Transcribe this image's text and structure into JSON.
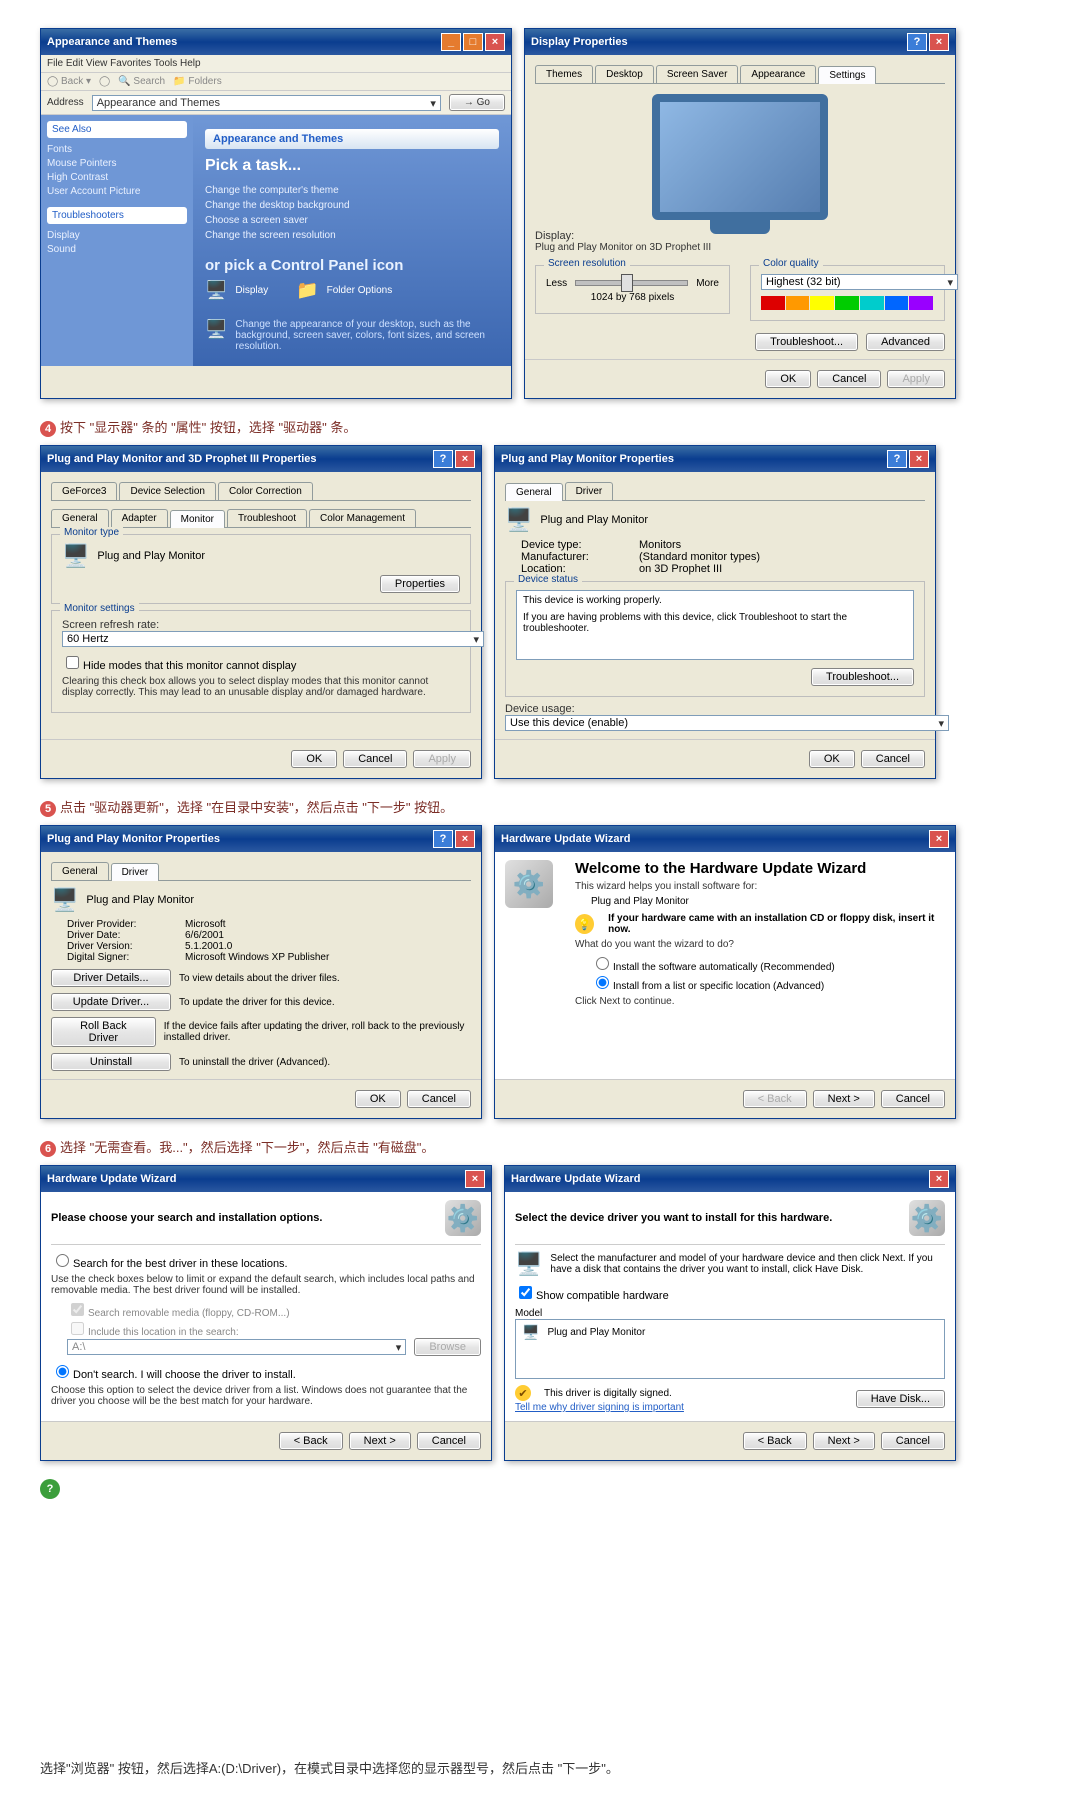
{
  "display_props": {
    "title": "Display Properties",
    "tabs": [
      "Themes",
      "Desktop",
      "Screen Saver",
      "Appearance",
      "Settings"
    ],
    "display_label": "Display:",
    "display_value": "Plug and Play Monitor on 3D Prophet III",
    "res_group": "Screen resolution",
    "res_less": "Less",
    "res_more": "More",
    "res_value": "1024 by 768 pixels",
    "quality_group": "Color quality",
    "quality_value": "Highest (32 bit)",
    "troubleshoot_btn": "Troubleshoot...",
    "advanced_btn": "Advanced",
    "ok": "OK",
    "cancel": "Cancel",
    "apply": "Apply"
  },
  "appearance_panel": {
    "title": "Appearance and Themes",
    "menu": "File  Edit  View  Favorites  Tools  Help",
    "addr_label": "Address",
    "addr_value": "Appearance and Themes",
    "pick_task": "Pick a task...",
    "links": [
      "Change the computer's theme",
      "Change the desktop background",
      "Choose a screen saver",
      "Change the screen resolution"
    ],
    "or_pick": "or pick a Control Panel icon",
    "icons": [
      "Display",
      "Folder Options"
    ],
    "change_desc": "Change the appearance of your desktop, such as the background, screen saver, colors, font sizes, and screen resolution."
  },
  "step4": "按下 \"显示器\" 条的 \"属性\" 按钮，选择 \"驱动器\" 条。",
  "pnp_3d": {
    "title": "Plug and Play Monitor and 3D Prophet III Properties",
    "tabs_row1": [
      "GeForce3",
      "Device Selection",
      "Color Correction"
    ],
    "tabs_row2": [
      "General",
      "Adapter",
      "Monitor",
      "Troubleshoot",
      "Color Management"
    ],
    "mon_type_group": "Monitor type",
    "mon_type_value": "Plug and Play Monitor",
    "properties_btn": "Properties",
    "mon_settings_group": "Monitor settings",
    "refresh_label": "Screen refresh rate:",
    "refresh_value": "60 Hertz",
    "hide_modes_chk": "Hide modes that this monitor cannot display",
    "hide_modes_desc": "Clearing this check box allows you to select display modes that this monitor cannot display correctly. This may lead to an unusable display and/or damaged hardware.",
    "ok": "OK",
    "cancel": "Cancel",
    "apply": "Apply"
  },
  "pnp_props": {
    "title": "Plug and Play Monitor Properties",
    "tabs": [
      "General",
      "Driver"
    ],
    "name": "Plug and Play Monitor",
    "device_type_label": "Device type:",
    "device_type": "Monitors",
    "manufacturer_label": "Manufacturer:",
    "manufacturer": "(Standard monitor types)",
    "location_label": "Location:",
    "location": "on 3D Prophet III",
    "status_group": "Device status",
    "status_text": "This device is working properly.",
    "status_help": "If you are having problems with this device, click Troubleshoot to start the troubleshooter.",
    "troubleshoot_btn": "Troubleshoot...",
    "usage_label": "Device usage:",
    "usage_value": "Use this device (enable)",
    "ok": "OK",
    "cancel": "Cancel"
  },
  "step5": "点击 \"驱动器更新\"，选择 \"在目录中安装\"，然后点击 \"下一步\" 按钮。",
  "driver_tab": {
    "title": "Plug and Play Monitor Properties",
    "tabs": [
      "General",
      "Driver"
    ],
    "name": "Plug and Play Monitor",
    "provider_label": "Driver Provider:",
    "provider": "Microsoft",
    "date_label": "Driver Date:",
    "date": "6/6/2001",
    "version_label": "Driver Version:",
    "version": "5.1.2001.0",
    "signer_label": "Digital Signer:",
    "signer": "Microsoft Windows XP Publisher",
    "details_btn": "Driver Details...",
    "details_desc": "To view details about the driver files.",
    "update_btn": "Update Driver...",
    "update_desc": "To update the driver for this device.",
    "rollback_btn": "Roll Back Driver",
    "rollback_desc": "If the device fails after updating the driver, roll back to the previously installed driver.",
    "uninstall_btn": "Uninstall",
    "uninstall_desc": "To uninstall the driver (Advanced).",
    "ok": "OK",
    "cancel": "Cancel"
  },
  "wizard1": {
    "title": "Hardware Update Wizard",
    "welcome": "Welcome to the Hardware Update Wizard",
    "helps": "This wizard helps you install software for:",
    "device": "Plug and Play Monitor",
    "cd_text": "If your hardware came with an installation CD or floppy disk, insert it now.",
    "what_do": "What do you want the wizard to do?",
    "opt1": "Install the software automatically (Recommended)",
    "opt2": "Install from a list or specific location (Advanced)",
    "click_next": "Click Next to continue.",
    "back": "< Back",
    "next": "Next >",
    "cancel": "Cancel"
  },
  "step6": "选择 \"无需查看。我...\"，然后选择 \"下一步\"，然后点击 \"有磁盘\"。",
  "wizard2": {
    "title": "Hardware Update Wizard",
    "header": "Please choose your search and installation options.",
    "opt_search": "Search for the best driver in these locations.",
    "search_desc": "Use the check boxes below to limit or expand the default search, which includes local paths and removable media. The best driver found will be installed.",
    "chk_media": "Search removable media (floppy, CD-ROM...)",
    "chk_include": "Include this location in the search:",
    "loc_value": "A:\\",
    "browse": "Browse",
    "opt_dont": "Don't search. I will choose the driver to install.",
    "dont_desc": "Choose this option to select the device driver from a list. Windows does not guarantee that the driver you choose will be the best match for your hardware.",
    "back": "< Back",
    "next": "Next >",
    "cancel": "Cancel"
  },
  "wizard3": {
    "title": "Hardware Update Wizard",
    "header": "Select the device driver you want to install for this hardware.",
    "desc": "Select the manufacturer and model of your hardware device and then click Next. If you have a disk that contains the driver you want to install, click Have Disk.",
    "show_compat": "Show compatible hardware",
    "model_label": "Model",
    "model_value": "Plug and Play Monitor",
    "signed": "This driver is digitally signed.",
    "tellme": "Tell me why driver signing is important",
    "have_disk": "Have Disk...",
    "back": "< Back",
    "next": "Next >",
    "cancel": "Cancel"
  },
  "final": "选择\"浏览器\" 按钮，然后选择A:(D:\\Driver)，在模式目录中选择您的显示器型号，然后点击 \"下一步\"。"
}
